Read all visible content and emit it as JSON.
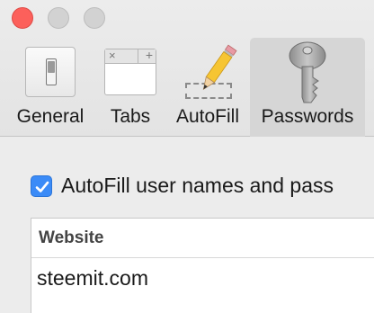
{
  "toolbar": {
    "tabs": [
      {
        "label": "General",
        "icon": "switch-icon"
      },
      {
        "label": "Tabs",
        "icon": "tabs-icon"
      },
      {
        "label": "AutoFill",
        "icon": "pencil-icon"
      },
      {
        "label": "Passwords",
        "icon": "key-icon",
        "selected": true
      }
    ]
  },
  "content": {
    "autofill_checkbox": {
      "label": "AutoFill user names and pass",
      "checked": true
    },
    "table": {
      "columns": [
        "Website"
      ],
      "rows": [
        [
          "steemit.com"
        ]
      ]
    }
  },
  "colors": {
    "close": "#fc605b",
    "checkbox": "#3b8bf7",
    "selected_tab": "#d6d6d6"
  }
}
